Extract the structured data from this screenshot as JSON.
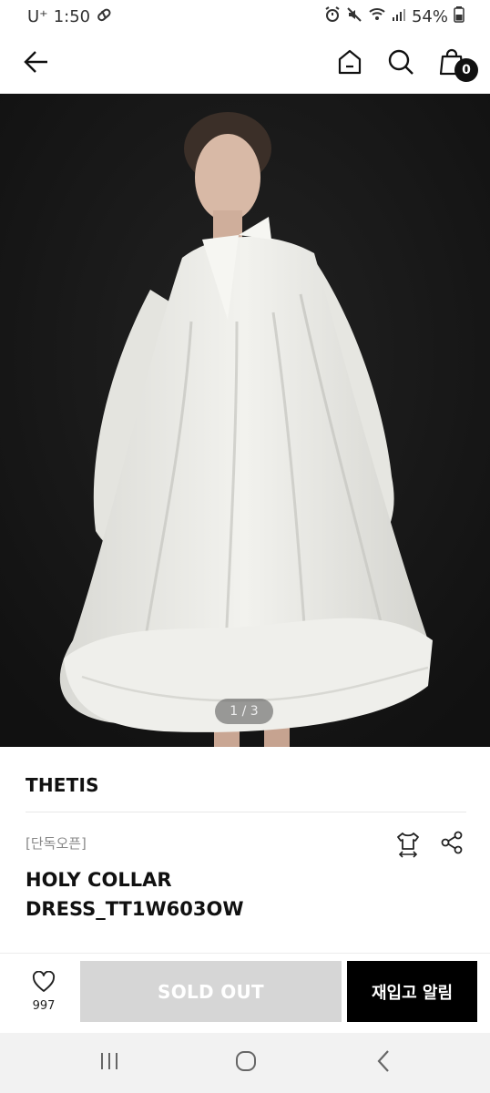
{
  "status_bar": {
    "carrier": "U⁺",
    "time": "1:50",
    "battery": "54%"
  },
  "header": {
    "cart_count": "0"
  },
  "gallery": {
    "pager": "1 / 3"
  },
  "product": {
    "brand": "THETIS",
    "badge": "[단독오픈]",
    "name_line1": "HOLY COLLAR",
    "name_line2": "DRESS_TT1W603OW"
  },
  "bottom_bar": {
    "like_count": "997",
    "soldout_label": "SOLD OUT",
    "restock_label": "재입고 알림"
  },
  "icons": {
    "back": "back-arrow-icon",
    "home": "home-icon",
    "search": "search-icon",
    "cart": "shopping-bag-icon",
    "size": "size-guide-icon",
    "share": "share-icon",
    "like": "heart-icon"
  },
  "colors": {
    "photo_background": "#171717",
    "soldout_background": "#d6d6d6",
    "restock_background": "#000000"
  }
}
